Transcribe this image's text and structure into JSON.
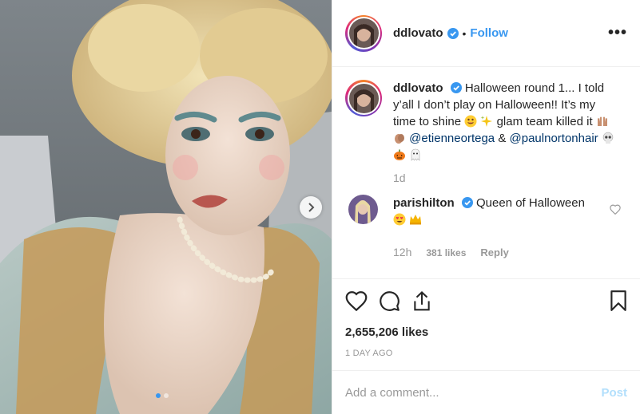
{
  "post": {
    "username": "ddlovato",
    "follow_label": "Follow",
    "separator": "•",
    "more_label": "•••",
    "caption": {
      "username": "ddlovato",
      "text_1": "Halloween round 1... I told y’all I don’t play on Halloween!! It’s my time to shine",
      "text_2": "glam team killed it",
      "mention_1": "@etienneortega",
      "amp": "&",
      "mention_2": "@paulnortonhair",
      "time": "1d"
    },
    "reply": {
      "username": "parishilton",
      "text": "Queen of Halloween",
      "time": "12h",
      "likes": "381 likes",
      "reply_label": "Reply"
    },
    "likes_count": "2,655,206 likes",
    "date": "1 DAY AGO",
    "comment_input": {
      "placeholder": "Add a comment...",
      "value": ""
    },
    "post_label": "Post"
  },
  "colors": {
    "link_blue": "#3897f0",
    "mention_blue": "#003569",
    "muted_gray": "#999999",
    "border": "#efefef"
  },
  "icons": [
    "verified-badge-icon",
    "more-options-icon",
    "heart-icon",
    "comment-icon",
    "share-icon",
    "bookmark-icon",
    "chevron-right-icon"
  ]
}
